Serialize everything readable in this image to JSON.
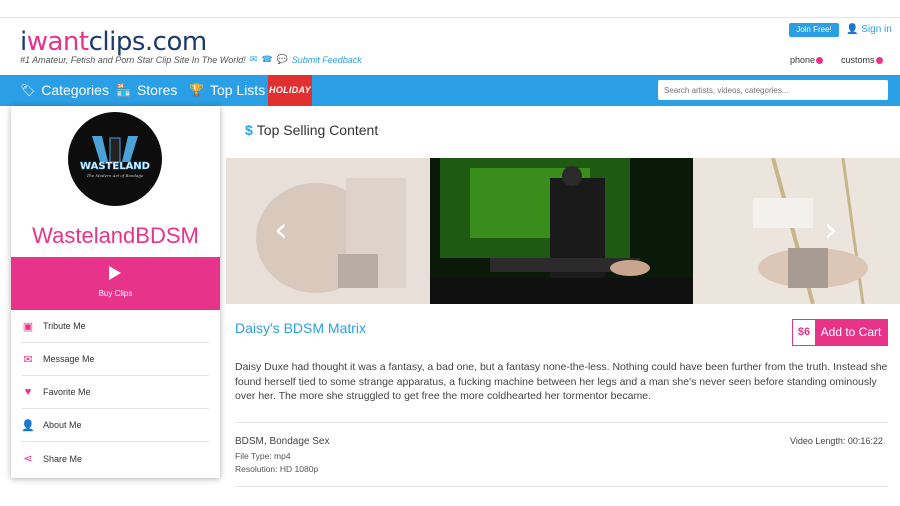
{
  "header": {
    "logo_i": "i",
    "logo_want": "want",
    "logo_rest": "clips.com",
    "tagline": "#1 Amateur, Fetish and Porn Star Clip Site In The World!",
    "feedback": "Submit Feedback",
    "join_label": "Join Free!",
    "signin_label": "Sign in",
    "phone_label": "phone",
    "customs_label": "customs"
  },
  "nav": {
    "items": [
      {
        "label": "Categories",
        "icon": "tag-icon"
      },
      {
        "label": "Stores",
        "icon": "store-icon"
      },
      {
        "label": "Top Lists",
        "icon": "trophy-icon"
      }
    ],
    "holiday_label": "HOLIDAY",
    "search_placeholder": "Search artists, videos, categories..."
  },
  "sidebar": {
    "store_name": "WastelandBDSM",
    "avatar_text": "WASTELAND",
    "avatar_subtext": "The Modern Art of Bondage",
    "buy_clips_label": "Buy Clips",
    "menu": [
      {
        "label": "Tribute Me",
        "icon": "money-icon"
      },
      {
        "label": "Message Me",
        "icon": "envelope-icon"
      },
      {
        "label": "Favorite Me",
        "icon": "heart-icon"
      },
      {
        "label": "About Me",
        "icon": "user-icon"
      },
      {
        "label": "Share Me",
        "icon": "share-icon"
      }
    ]
  },
  "main": {
    "section_title": "Top Selling Content",
    "clip_title": "Daisy's BDSM Matrix",
    "price": "$6",
    "add_to_cart_label": "Add to Cart",
    "description": "Daisy Duxe had thought it was a fantasy, a bad one, but a fantasy none-the-less. Nothing could have been further from the truth. Instead she found herself tied to some strange apparatus, a fucking machine between her legs and a man she's never seen before standing ominously over her. The more she struggled to get free the more coldhearted her tormentor became.",
    "tags": "BDSM, Bondage Sex",
    "file_type": "File Type: mp4",
    "resolution": "Resolution: HD 1080p",
    "video_length": "Video Length: 00:16:22"
  },
  "colors": {
    "accent_blue": "#2a9fe6",
    "accent_pink": "#e8338b",
    "holiday_red": "#e03030"
  }
}
